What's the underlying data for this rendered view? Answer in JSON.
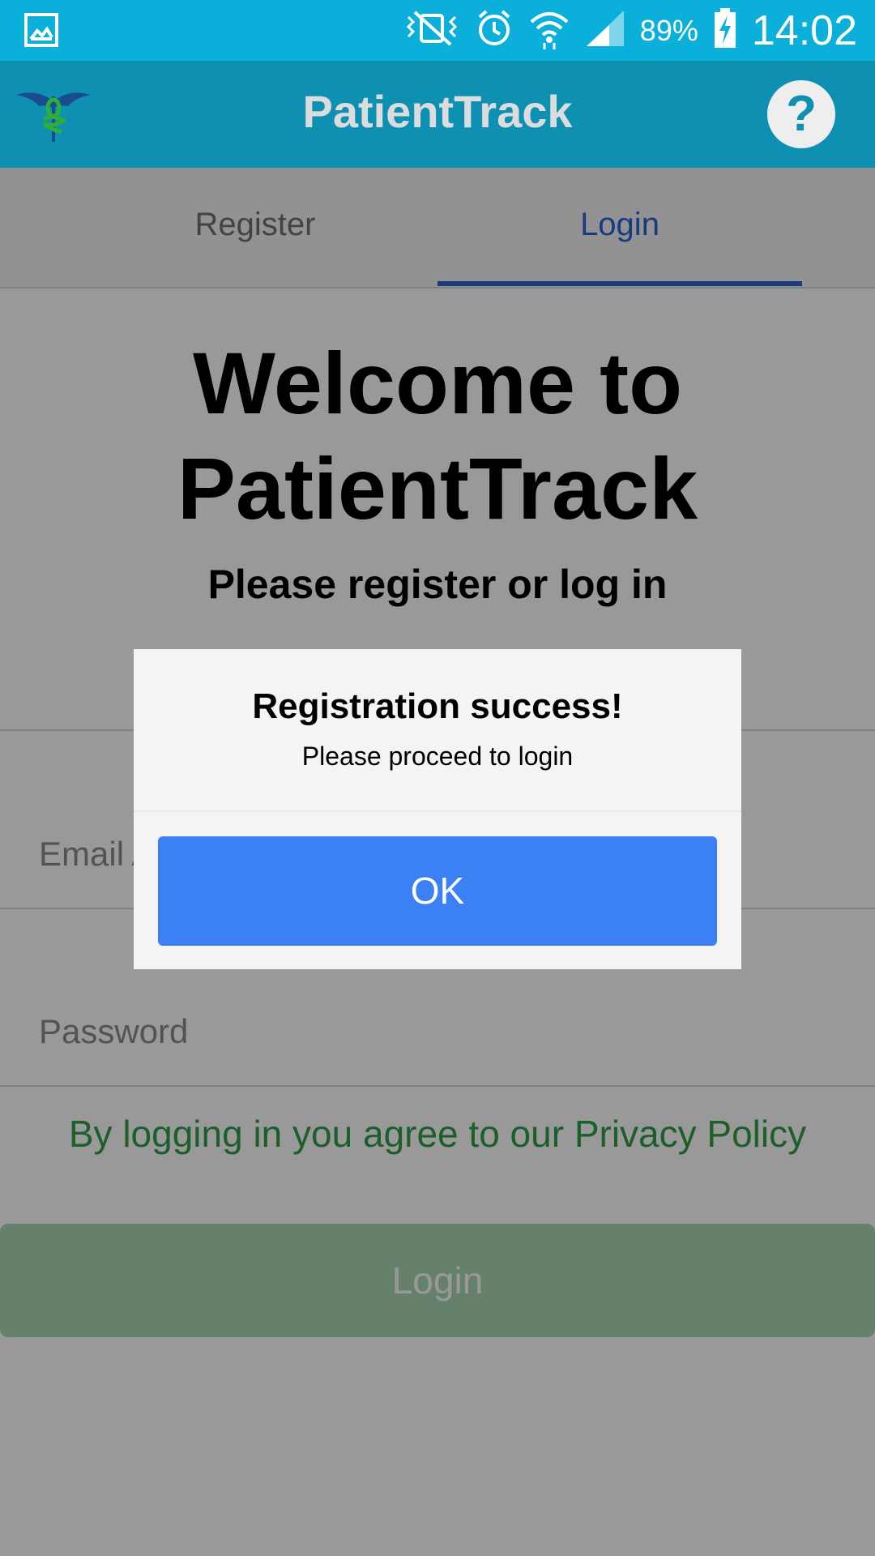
{
  "status_bar": {
    "battery_pct": "89%",
    "time": "14:02",
    "icons": [
      "gallery-icon",
      "vibrate-mute-icon",
      "alarm-icon",
      "wifi-icon",
      "signal-icon",
      "battery-charging-icon"
    ]
  },
  "app_bar": {
    "title": "PatientTrack",
    "help_label": "?"
  },
  "tabs": [
    {
      "label": "Register",
      "active": false
    },
    {
      "label": "Login",
      "active": true
    }
  ],
  "content": {
    "welcome": "Welcome to PatientTrack",
    "subtitle": "Please register or log in",
    "email_placeholder": "Email Address",
    "password_placeholder": "Password",
    "privacy_text": "By logging in you agree to our Privacy Policy",
    "login_button": "Login"
  },
  "dialog": {
    "title": "Registration success!",
    "message": "Please proceed to login",
    "ok_label": "OK"
  },
  "colors": {
    "status_bar": "#0ab0d9",
    "app_bar": "#0e90b3",
    "tab_active": "#2a62d8",
    "privacy_green": "#2f9e48",
    "login_button": "#a8d8b3",
    "dialog_button": "#3b80f5"
  }
}
